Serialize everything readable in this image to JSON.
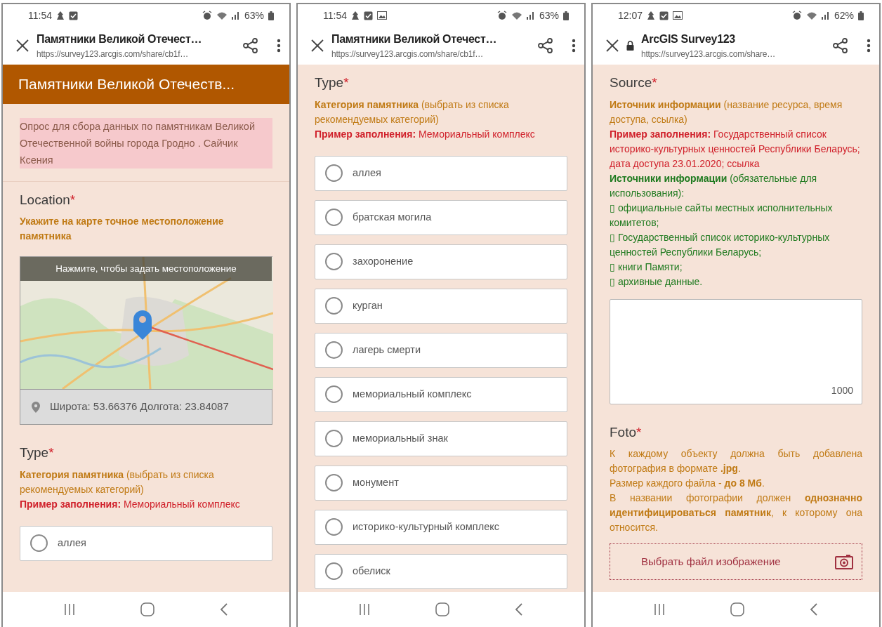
{
  "screens": [
    {
      "status_bar": {
        "time": "11:54",
        "notification_icons": [
          {
            "kind": "app"
          },
          {
            "kind": "checkbox"
          }
        ],
        "battery": "63%"
      },
      "browser_bar": {
        "secure": false,
        "title": "Памятники Великой Отечест…",
        "url": "https://survey123.arcgis.com/share/cb1f…"
      },
      "blocks": [
        {
          "kind": "header",
          "text": "Памятники Великой Отечеств..."
        },
        {
          "kind": "intro",
          "text": "Опрос для сбора данных по памятникам Великой Отечественной войны города Гродно . Сайчик Ксения"
        },
        {
          "kind": "question",
          "title": "Location",
          "marker": "*",
          "hints": [
            {
              "text": "Укажите на карте точное местоположение памятника",
              "color": "#c07a14",
              "bold": true
            }
          ]
        },
        {
          "kind": "map",
          "overlay": "Нажмите, чтобы задать местоположение",
          "coordinates": "Широта: 53.66376  Долгота: 23.84087"
        },
        {
          "kind": "question",
          "title": "Type",
          "marker": "*",
          "hints": [
            {
              "text": "**Категория памятника** (выбрать из списка рекомендуемых категорий)",
              "color": "#c07a14"
            },
            {
              "text": "**Пример заполнения:** Мемориальный комплекс",
              "color": "#d0202a"
            }
          ]
        },
        {
          "kind": "choices",
          "options": [
            {
              "label": "аллея",
              "selected": false
            }
          ]
        }
      ]
    },
    {
      "status_bar": {
        "time": "11:54",
        "notification_icons": [
          {
            "kind": "app"
          },
          {
            "kind": "checkbox"
          },
          {
            "kind": "gallery"
          }
        ],
        "battery": "63%"
      },
      "browser_bar": {
        "secure": false,
        "title": "Памятники Великой Отечест…",
        "url": "https://survey123.arcgis.com/share/cb1f…"
      },
      "blocks": [
        {
          "kind": "question",
          "title": "Type",
          "marker": "*",
          "hints": [
            {
              "text": "**Категория памятника** (выбрать из списка рекомендуемых категорий)",
              "color": "#c07a14"
            },
            {
              "text": "**Пример заполнения:** Мемориальный комплекс",
              "color": "#d0202a"
            }
          ]
        },
        {
          "kind": "choices",
          "options": [
            {
              "label": "аллея",
              "selected": false
            },
            {
              "label": "братская могила",
              "selected": false
            },
            {
              "label": "захоронение",
              "selected": false
            },
            {
              "label": "курган",
              "selected": false
            },
            {
              "label": "лагерь смерти",
              "selected": false
            },
            {
              "label": "мемориальный комплекс",
              "selected": false
            },
            {
              "label": "мемориальный знак",
              "selected": false
            },
            {
              "label": "монумент",
              "selected": false
            },
            {
              "label": "историко-культурный комплекс",
              "selected": false
            },
            {
              "label": "обелиск",
              "selected": false
            }
          ]
        }
      ]
    },
    {
      "status_bar": {
        "time": "12:07",
        "notification_icons": [
          {
            "kind": "app"
          },
          {
            "kind": "checkbox"
          },
          {
            "kind": "gallery"
          }
        ],
        "battery": "62%"
      },
      "browser_bar": {
        "secure": true,
        "title": "ArcGIS Survey123",
        "url": "https://survey123.arcgis.com/share…"
      },
      "blocks": [
        {
          "kind": "question",
          "title": "Source",
          "marker": "*",
          "hints": [
            {
              "text": "**Источник информации** (название ресурса, время доступа, ссылка)",
              "color": "#c07a14"
            },
            {
              "text": "**Пример заполнения:** Государственный список историко-культурных ценностей Республики Беларусь; дата доступа 23.01.2020; ссылка",
              "color": "#d0202a"
            },
            {
              "text": "**Источники информации** (обязательные для использования):",
              "color": "#1f7a1f"
            },
            {
              "text": "▯ официальные сайты местных исполнительных комитетов;",
              "color": "#1f7a1f"
            },
            {
              "text": "▯ Государственный список историко-культурных ценностей Республики Беларусь;",
              "color": "#1f7a1f"
            },
            {
              "text": "▯ книги Памяти;",
              "color": "#1f7a1f"
            },
            {
              "text": "▯ архивные данные.",
              "color": "#1f7a1f"
            }
          ]
        },
        {
          "kind": "textarea",
          "counter": "1000"
        },
        {
          "kind": "question",
          "title": "Foto",
          "marker": "*",
          "hints": [
            {
              "text": "К каждому объекту должна быть добавлена фотография в формате **.jpg**.",
              "color": "#c07a14",
              "justified": true
            },
            {
              "text": "Размер каждого файла - **до 8 Мб**.",
              "color": "#c07a14"
            },
            {
              "text": "В названии фотографии должен **однозначно идентифицироваться памятник**, к которому она относится.",
              "color": "#c07a14",
              "justified": true
            }
          ]
        },
        {
          "kind": "file",
          "label": "Выбрать файл изображение"
        }
      ]
    }
  ]
}
